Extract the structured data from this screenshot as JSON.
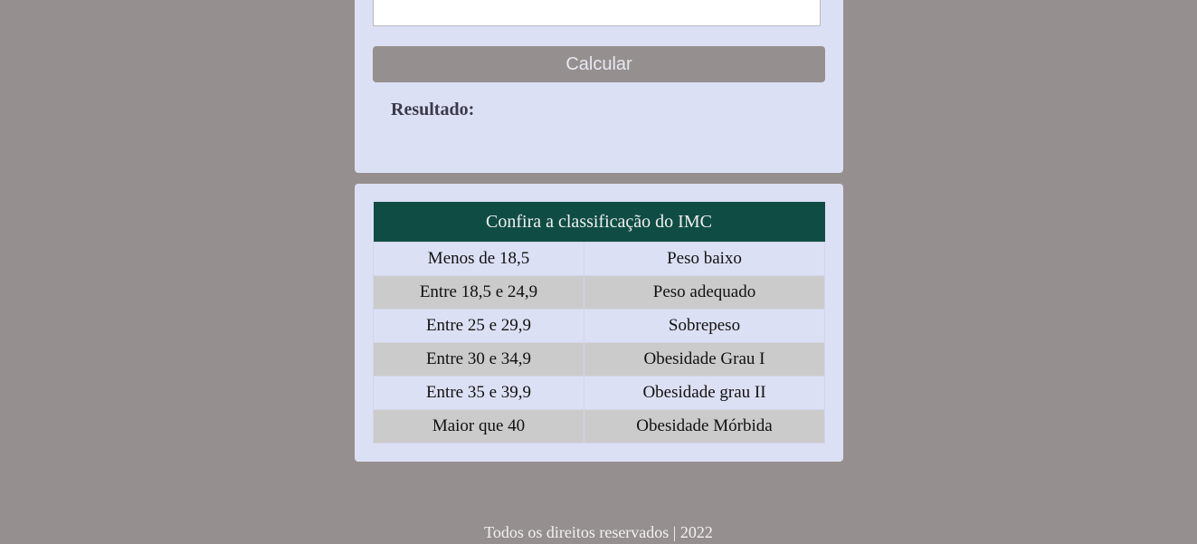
{
  "form": {
    "input_value": "",
    "calculate_label": "Calcular",
    "result_label": "Resultado:"
  },
  "classification": {
    "title": "Confira a classificação do IMC",
    "rows": [
      {
        "range": "Menos de 18,5",
        "category": "Peso baixo"
      },
      {
        "range": "Entre 18,5 e 24,9",
        "category": "Peso adequado"
      },
      {
        "range": "Entre 25 e 29,9",
        "category": "Sobrepeso"
      },
      {
        "range": "Entre 30 e 34,9",
        "category": "Obesidade Grau I"
      },
      {
        "range": "Entre 35 e 39,9",
        "category": "Obesidade grau II"
      },
      {
        "range": "Maior que 40",
        "category": "Obesidade Mórbida"
      }
    ]
  },
  "footer": {
    "text": "Todos os direitos reservados | 2022"
  },
  "colors": {
    "background": "#968f8f",
    "card": "#dce0f4",
    "table_header": "#0f4d44",
    "row_alt": "#cbcbcb",
    "button": "#958f8f"
  }
}
